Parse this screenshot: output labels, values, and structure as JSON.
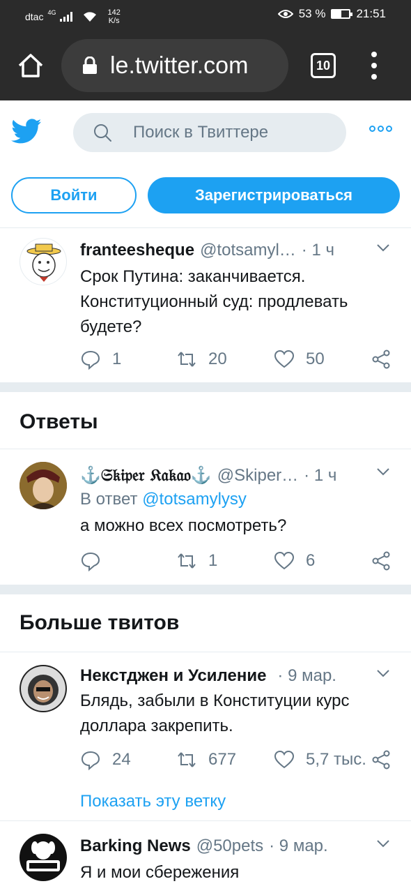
{
  "status_bar": {
    "carrier": "dtac",
    "network": "4G",
    "speed_value": "142",
    "speed_unit": "K/s",
    "battery": "53 %",
    "battery_level": 0.53,
    "time": "21:51"
  },
  "browser": {
    "url": "le.twitter.com",
    "tab_count": "10"
  },
  "twitter": {
    "search_placeholder": "Поиск в Твиттере",
    "login_label": "Войти",
    "signup_label": "Зарегистрироваться",
    "main_tweet": {
      "name": "franteesheque",
      "handle": "@totsamyl…",
      "time": "· 1 ч",
      "text": "Срок Путина: заканчивается. Конституционный суд: продлевать будете?",
      "replies": "1",
      "retweets": "20",
      "likes": "50"
    },
    "replies_heading": "Ответы",
    "reply_tweet": {
      "name": "⚓𝔖𝔨𝔦𝔭𝔢𝔯 𝔎𝔞𝔨𝔞𝔬⚓",
      "handle": "@Skiper…",
      "time": "· 1 ч",
      "reply_prefix": "В ответ",
      "reply_mention": "@totsamylysy",
      "text": "а можно всех посмотреть?",
      "replies": "",
      "retweets": "1",
      "likes": "6"
    },
    "more_heading": "Больше твитов",
    "more_tweets": [
      {
        "name": "Некстджен и Усиление",
        "handle": "",
        "time": "· 9 мар.",
        "text": "Блядь, забыли в Конституции курс доллара закрепить.",
        "replies": "24",
        "retweets": "677",
        "likes": "5,7 тыс.",
        "thread_link": "Показать эту ветку"
      },
      {
        "name": "Barking News",
        "handle": "@50pets",
        "time": "· 9 мар.",
        "text": "Я и мои сбережения"
      }
    ]
  },
  "colors": {
    "accent": "#1da1f2",
    "secondary_text": "#657786",
    "browser_chrome": "#2b2b2b"
  }
}
